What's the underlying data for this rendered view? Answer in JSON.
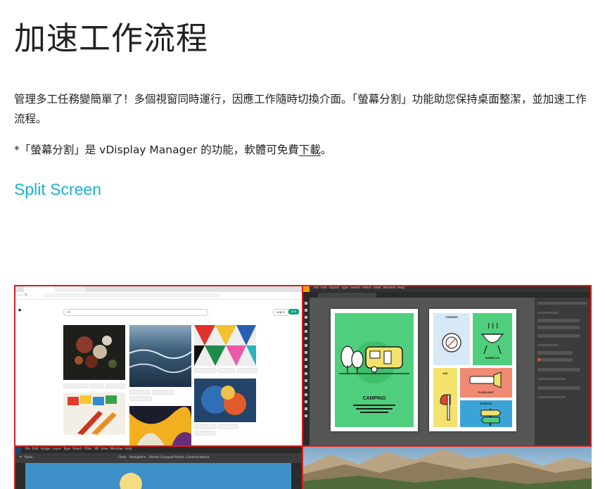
{
  "page": {
    "title": "加速工作流程",
    "paragraph": "管理多工任務變簡單了！多個視窗同時運行，因應工作隨時切換介面。「螢幕分割」功能助您保持桌面整潔，並加速工作流程。",
    "note_prefix": "*「螢幕分割」是 vDisplay Manager 的功能，軟體可免費",
    "note_link": "下載",
    "note_suffix": "。",
    "subtitle": "Split Screen"
  },
  "screenshot": {
    "divider_color": "#d8201c",
    "browser": {
      "search_placeholder": "art",
      "login_label": "Log in",
      "join_label": "Join",
      "join_color": "#05a081"
    },
    "illustrator": {
      "menu_items": [
        "File",
        "Edit",
        "Object",
        "Type",
        "Select",
        "Effect",
        "View",
        "Window",
        "Help"
      ],
      "camping_title": "CAMPING",
      "tiles": [
        "COMPASS",
        "BARBECUE",
        "AXE",
        "FLASHLIGHT",
        "SIGNPOST"
      ]
    },
    "photoshop": {
      "menu_items": [
        "File",
        "Edit",
        "Image",
        "Layer",
        "Type",
        "Select",
        "Filter",
        "3D",
        "View",
        "Window",
        "Help"
      ],
      "options": [
        "Ratio",
        "Clear",
        "Straighten",
        "Delete Cropped Pixels",
        "Content-Aware"
      ]
    }
  }
}
